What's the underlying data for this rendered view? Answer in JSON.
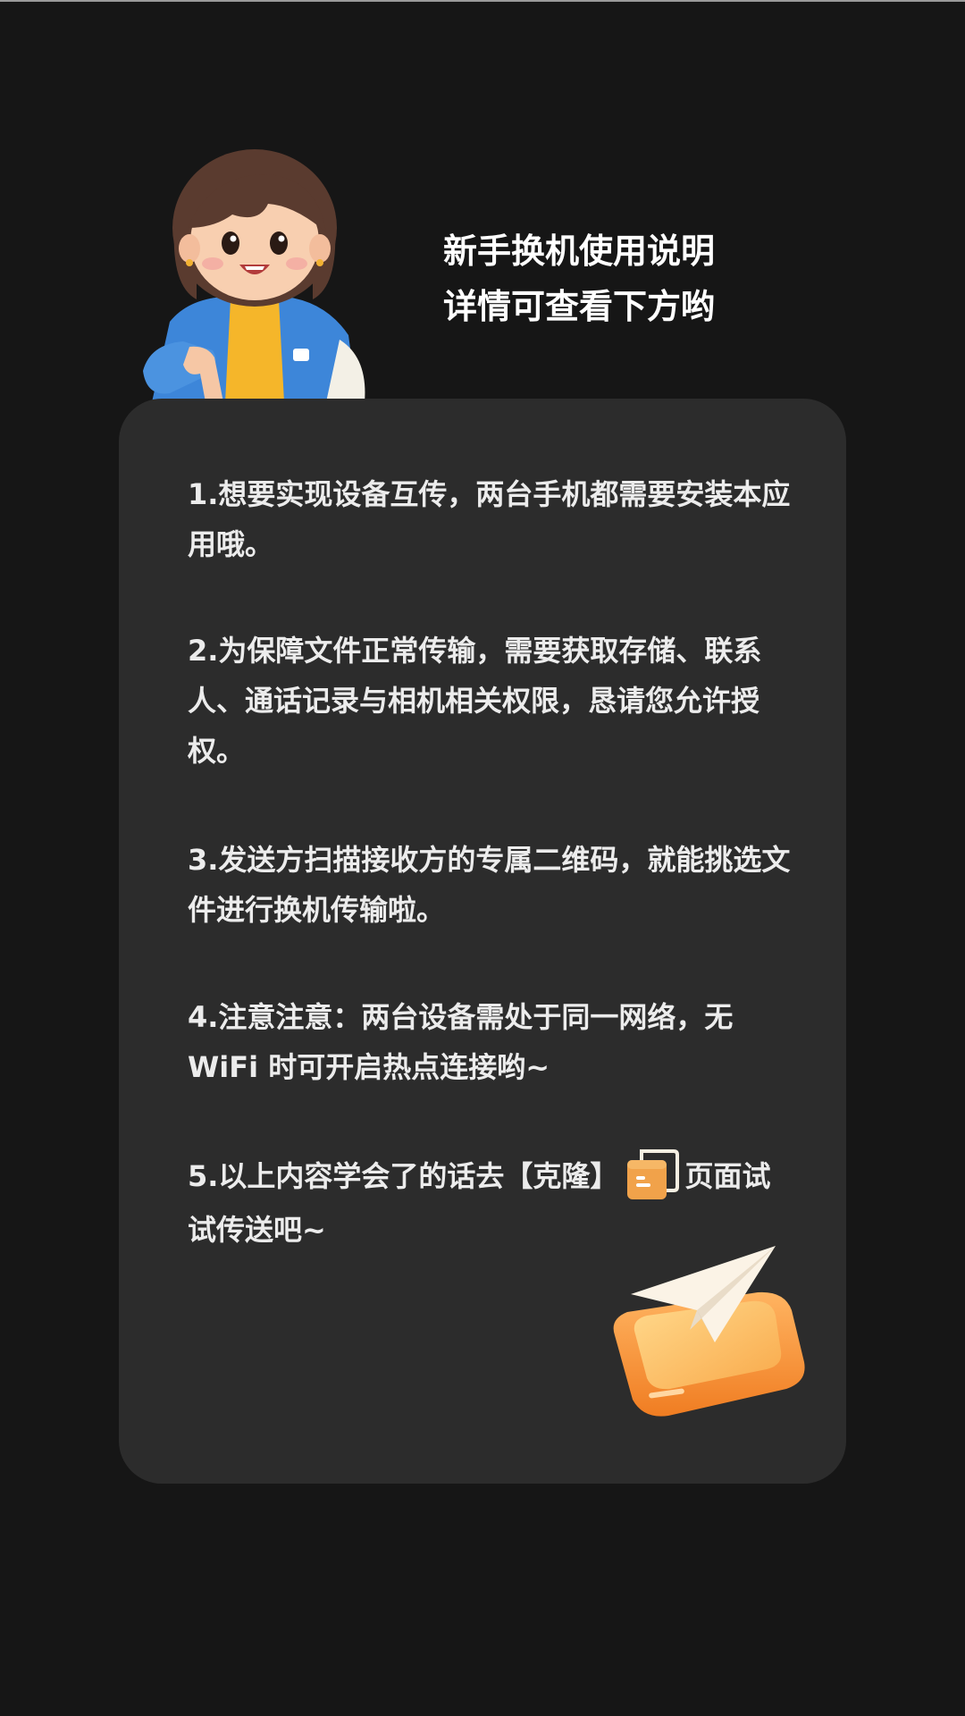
{
  "header": {
    "line1": "新手换机使用说明",
    "line2": "详情可查看下方哟"
  },
  "tips": [
    {
      "text": "1.想要实现设备互传，两台手机都需要安装本应用哦。"
    },
    {
      "text": "2.为保障文件正常传输，需要获取存储、联系人、通话记录与相机相关权限，恳请您允许授权。"
    },
    {
      "text": "3.发送方扫描接收方的专属二维码，就能挑选文件进行换机传输啦。"
    },
    {
      "text": "4.注意注意：两台设备需处于同一网络，无WiFi 时可开启热点连接哟~"
    },
    {
      "text_before": "5.以上内容学会了的话去【克隆】",
      "text_after": "页面试试传送吧~"
    }
  ],
  "colors": {
    "background": "#161616",
    "card": "#2c2c2c",
    "text": "#ececec",
    "title": "#ffffff",
    "accent": "#f29b3c"
  },
  "icons": {
    "mascot": "girl-pointing-illustration",
    "inline": "clone-folder-icon",
    "send": "paper-plane-box-illustration"
  }
}
